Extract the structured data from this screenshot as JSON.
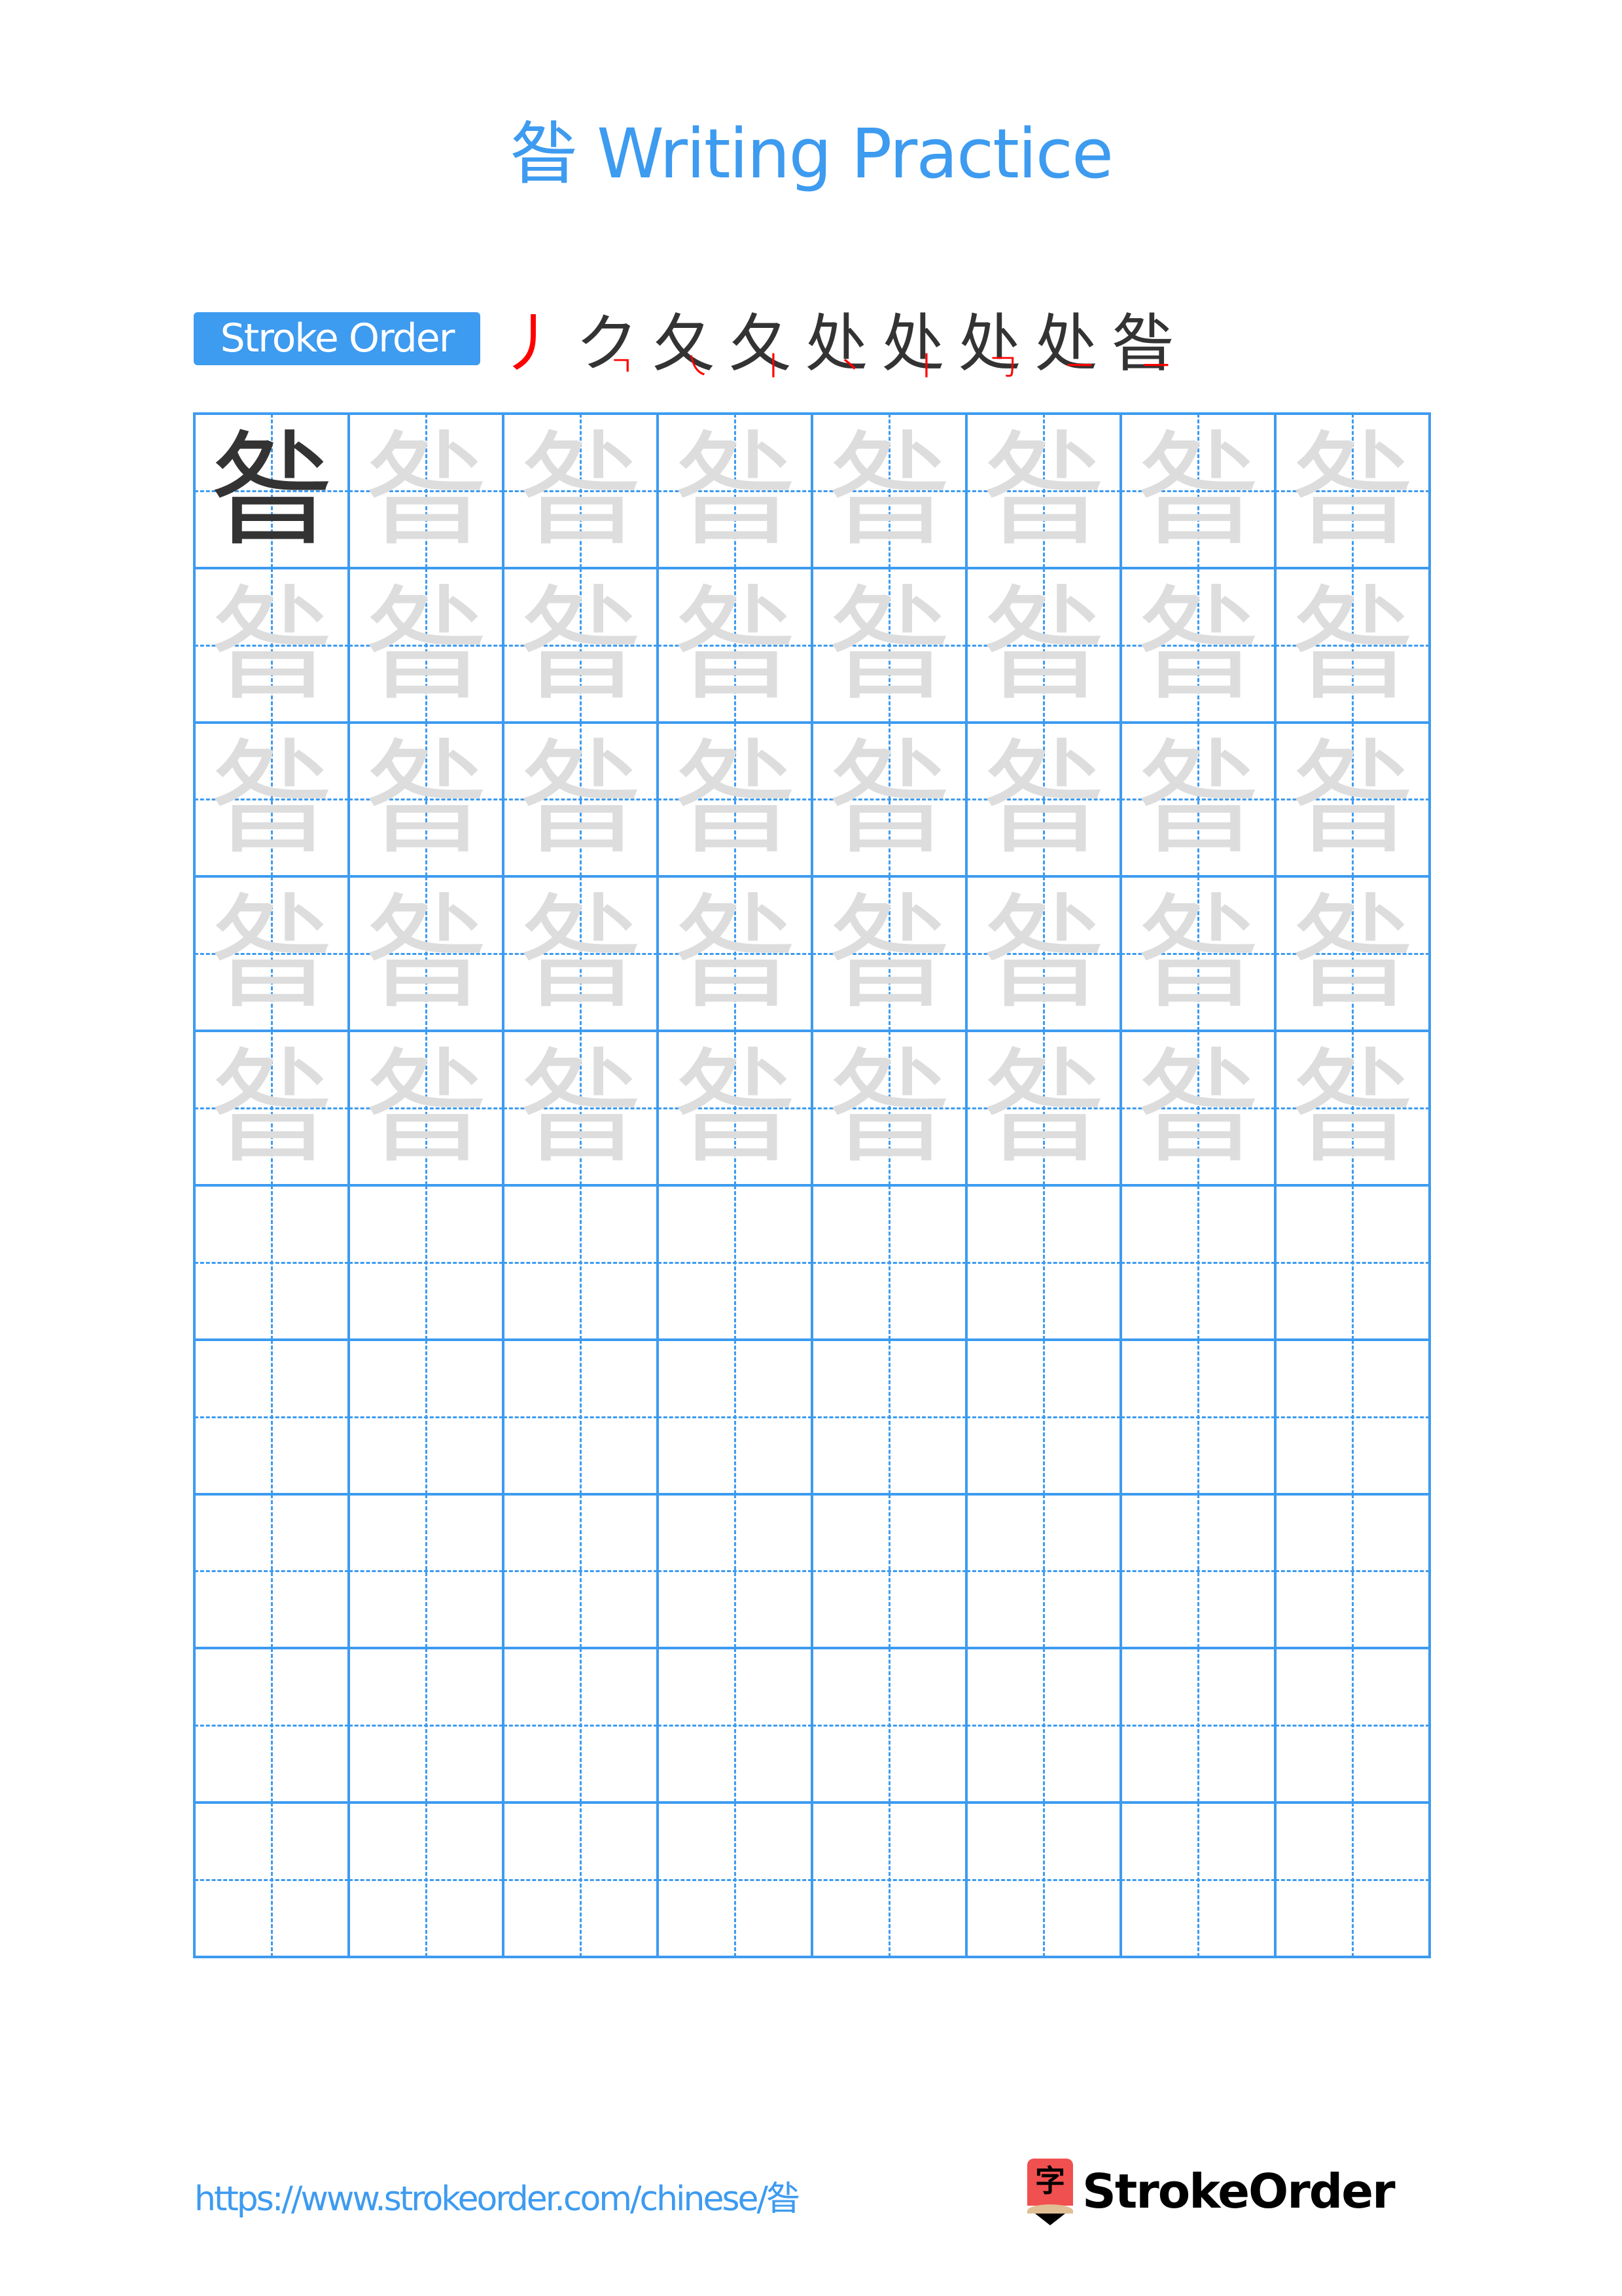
{
  "page": {
    "title": "昝 Writing Practice",
    "character": "昝"
  },
  "stroke_order": {
    "label": "Stroke Order",
    "step_count": 9,
    "steps": [
      {
        "index": 1,
        "glyph": "丿",
        "new_stroke": "丿"
      },
      {
        "index": 2,
        "glyph": "ク",
        "new_stroke": "ㄱ"
      },
      {
        "index": 3,
        "glyph": "夂",
        "new_stroke": "㇏"
      },
      {
        "index": 4,
        "glyph": "夂丨",
        "new_stroke": "丨"
      },
      {
        "index": 5,
        "glyph": "处",
        "new_stroke": "丶"
      },
      {
        "index": 6,
        "glyph": "处丨",
        "new_stroke": "丨"
      },
      {
        "index": 7,
        "glyph": "处冂",
        "new_stroke": "𠃌"
      },
      {
        "index": 8,
        "glyph": "处月",
        "new_stroke": "一"
      },
      {
        "index": 9,
        "glyph": "昝",
        "new_stroke": "一"
      }
    ],
    "colors": {
      "completed": "#333333",
      "current": "#ff0000"
    }
  },
  "practice_grid": {
    "columns": 8,
    "rows": 10,
    "traced_rows": 5,
    "model_cells": 1,
    "character": "昝",
    "colors": {
      "grid_line": "#3d9bf0",
      "model": "#333333",
      "trace": "#dddddd"
    }
  },
  "footer": {
    "url": "https://www.strokeorder.com/chinese/昝",
    "logo_glyph": "字",
    "logo_text": "StrokeOrder",
    "logo_colors": {
      "pencil": "#f05050",
      "wood": "#e0bf95",
      "tip": "#000000"
    }
  }
}
